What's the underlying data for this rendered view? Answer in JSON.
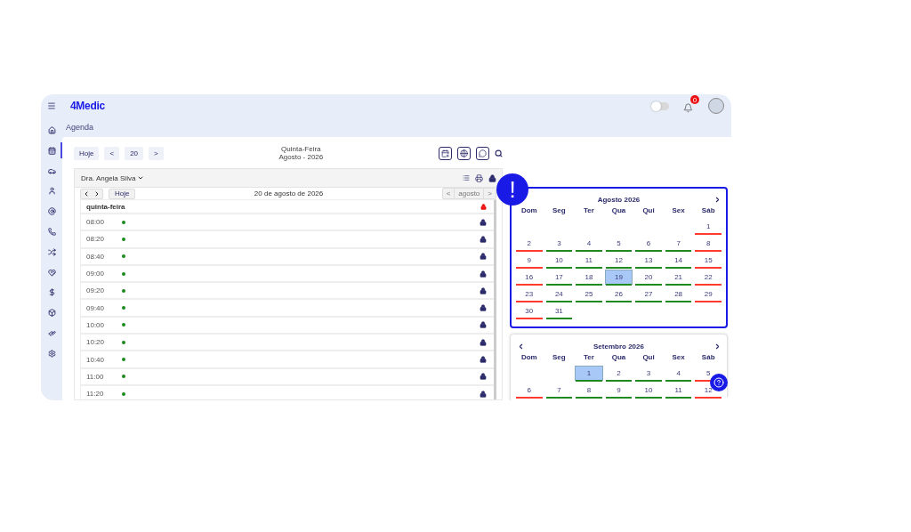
{
  "topbar": {
    "logo": "4Medic",
    "toggle_on": false,
    "notifications": "0"
  },
  "sidebar": {
    "items": [
      {
        "selected": false
      },
      {
        "selected": true
      },
      {
        "selected": false
      },
      {
        "selected": false
      },
      {
        "selected": false
      },
      {
        "selected": false
      },
      {
        "selected": false
      },
      {
        "selected": false
      },
      {
        "selected": false
      },
      {
        "selected": false
      },
      {
        "selected": false
      },
      {
        "selected": false
      }
    ]
  },
  "breadcrumb": "Agenda",
  "toolbar": {
    "buttons": [
      "Hoje",
      "<",
      "20",
      ">"
    ],
    "weekday": "Quinta-Feira",
    "month": "Agosto - 2026"
  },
  "doctor": "Dra. Angela Silva",
  "day_view": {
    "today_button": "Hoje",
    "title": "20 de agosto de 2026",
    "month_prev": "<",
    "month": "agosto",
    "month_next": ">",
    "header": "quinta-feira",
    "slots": [
      {
        "time": "08:00"
      },
      {
        "time": "08:20"
      },
      {
        "time": "08:40"
      },
      {
        "time": "09:00"
      },
      {
        "time": "09:20"
      },
      {
        "time": "09:40"
      },
      {
        "time": "10:00"
      },
      {
        "time": "10:20"
      },
      {
        "time": "10:40"
      },
      {
        "time": "11:00"
      },
      {
        "time": "11:20"
      }
    ]
  },
  "alert_badge": "!",
  "calendars": [
    {
      "title": "Agosto 2026",
      "prev": false,
      "next": true,
      "focused": true,
      "weekdays": [
        "Dom",
        "Seg",
        "Ter",
        "Qua",
        "Qui",
        "Sex",
        "Sáb"
      ],
      "weeks": [
        [
          {
            "day": "1",
            "color": "#ff3b30",
            "selected": false
          }
        ],
        [
          {
            "day": "2",
            "color": "#ff3b30",
            "selected": false
          },
          {
            "day": "3",
            "color": "#1f8a1f",
            "selected": false
          },
          {
            "day": "4",
            "color": "#1f8a1f",
            "selected": false
          },
          {
            "day": "5",
            "color": "#1f8a1f",
            "selected": false
          },
          {
            "day": "6",
            "color": "#1f8a1f",
            "selected": false
          },
          {
            "day": "7",
            "color": "#1f8a1f",
            "selected": false
          },
          {
            "day": "8",
            "color": "#ff3b30",
            "selected": false
          }
        ],
        [
          {
            "day": "9",
            "color": "#ff3b30",
            "selected": false
          },
          {
            "day": "10",
            "color": "#1f8a1f",
            "selected": false
          },
          {
            "day": "11",
            "color": "#1f8a1f",
            "selected": false
          },
          {
            "day": "12",
            "color": "#1f8a1f",
            "selected": false
          },
          {
            "day": "13",
            "color": "#1f8a1f",
            "selected": false
          },
          {
            "day": "14",
            "color": "#1f8a1f",
            "selected": false
          },
          {
            "day": "15",
            "color": "#ff3b30",
            "selected": false
          }
        ],
        [
          {
            "day": "16",
            "color": "#ff3b30",
            "selected": false
          },
          {
            "day": "17",
            "color": "#1f8a1f",
            "selected": false
          },
          {
            "day": "18",
            "color": "#1f8a1f",
            "selected": false
          },
          {
            "day": "19",
            "color": "#1f8a1f",
            "selected": true
          },
          {
            "day": "20",
            "color": "#1f8a1f",
            "selected": false
          },
          {
            "day": "21",
            "color": "#1f8a1f",
            "selected": false
          },
          {
            "day": "22",
            "color": "#ff3b30",
            "selected": false
          }
        ],
        [
          {
            "day": "23",
            "color": "#ff3b30",
            "selected": false
          },
          {
            "day": "24",
            "color": "#1f8a1f",
            "selected": false
          },
          {
            "day": "25",
            "color": "#1f8a1f",
            "selected": false
          },
          {
            "day": "26",
            "color": "#1f8a1f",
            "selected": false
          },
          {
            "day": "27",
            "color": "#1f8a1f",
            "selected": false
          },
          {
            "day": "28",
            "color": "#1f8a1f",
            "selected": false
          },
          {
            "day": "29",
            "color": "#ff3b30",
            "selected": false
          }
        ],
        [
          {
            "day": "30",
            "color": "#ff3b30",
            "selected": false
          },
          {
            "day": "31",
            "color": "#1f8a1f",
            "selected": false
          }
        ]
      ]
    },
    {
      "title": "Setembro 2026",
      "prev": true,
      "next": true,
      "focused": false,
      "weekdays": [
        "Dom",
        "Seg",
        "Ter",
        "Qua",
        "Qui",
        "Sex",
        "Sáb"
      ],
      "weeks": [
        [
          {
            "day": "1",
            "color": "#1f8a1f",
            "selected": true
          },
          {
            "day": "2",
            "color": "#1f8a1f",
            "selected": false
          },
          {
            "day": "3",
            "color": "#1f8a1f",
            "selected": false
          },
          {
            "day": "4",
            "color": "#1f8a1f",
            "selected": false
          },
          {
            "day": "5",
            "color": "#ff3b30",
            "selected": false
          }
        ],
        [
          {
            "day": "6",
            "color": "#ff3b30",
            "selected": false
          },
          {
            "day": "7",
            "color": "#1f8a1f",
            "selected": false
          },
          {
            "day": "8",
            "color": "#1f8a1f",
            "selected": false
          },
          {
            "day": "9",
            "color": "#1f8a1f",
            "selected": false
          },
          {
            "day": "10",
            "color": "#1f8a1f",
            "selected": false
          },
          {
            "day": "11",
            "color": "#1f8a1f",
            "selected": false
          },
          {
            "day": "12",
            "color": "#ff3b30",
            "selected": false
          }
        ]
      ]
    }
  ]
}
